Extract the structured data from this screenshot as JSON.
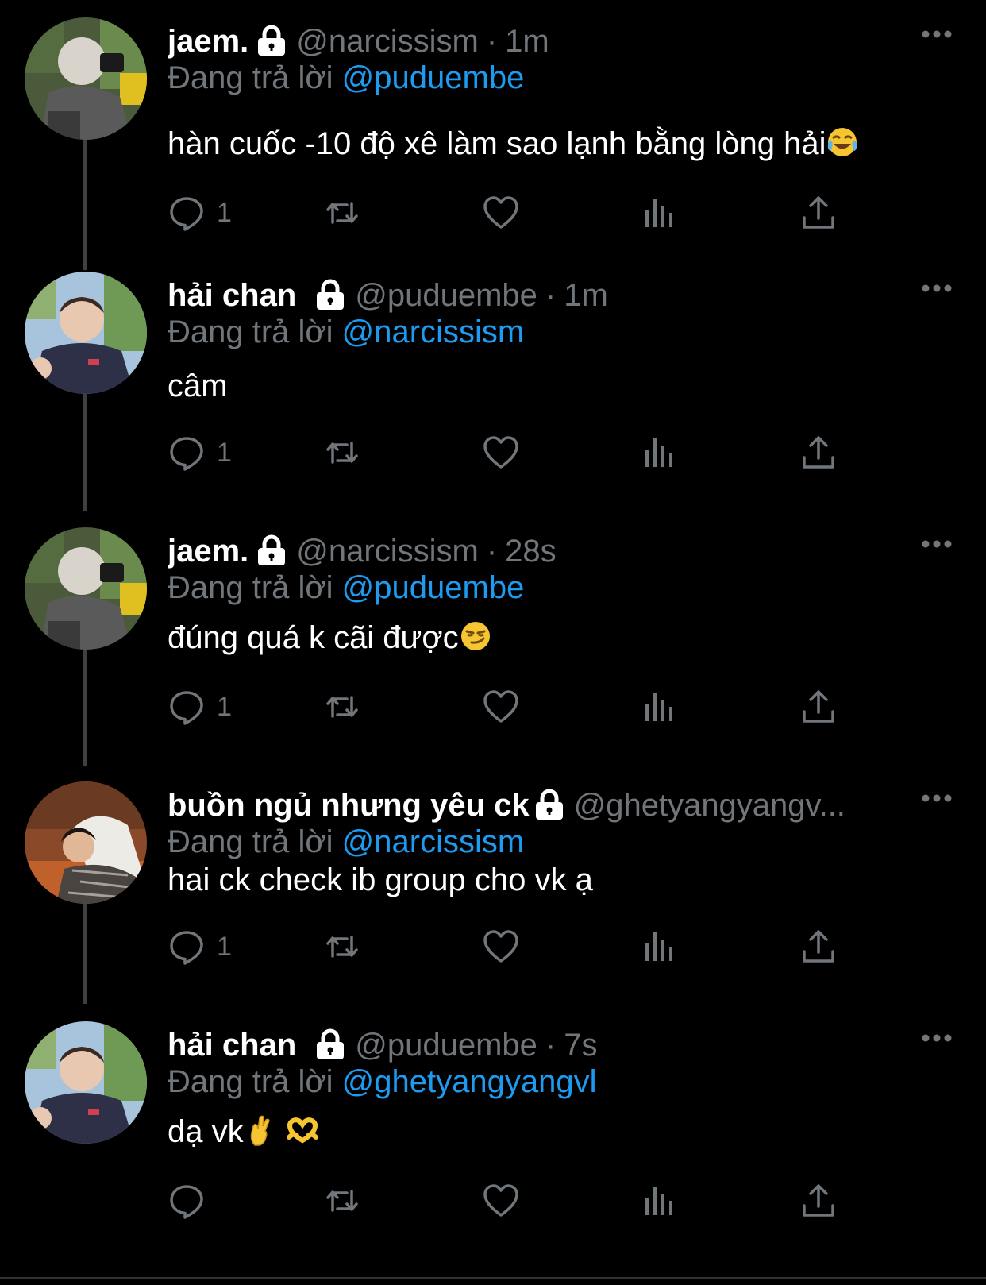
{
  "tweets": [
    {
      "name": "jaem.",
      "handle": "@narcissism",
      "separator": "·",
      "time": "1m",
      "reply_prefix": "Đang trả lời",
      "reply_to": "@puduembe",
      "text": "hàn cuốc -10 độ xê làm sao lạnh bằng lòng hải",
      "reply_count": "1"
    },
    {
      "name": "hải chan",
      "handle": "@puduembe",
      "separator": "·",
      "time": "1m",
      "reply_prefix": "Đang trả lời",
      "reply_to": "@narcissism",
      "text": "câm",
      "reply_count": "1"
    },
    {
      "name": "jaem.",
      "handle": "@narcissism",
      "separator": "·",
      "time": "28s",
      "reply_prefix": "Đang trả lời",
      "reply_to": "@puduembe",
      "text": "đúng quá k cãi được",
      "reply_count": "1"
    },
    {
      "name": "buồn ngủ nhưng yêu ck",
      "handle": "@ghetyangyangv...",
      "separator": "",
      "time": "",
      "reply_prefix": "Đang trả lời",
      "reply_to": "@narcissism",
      "text": "hai ck check ib group cho vk ạ",
      "reply_count": "1"
    },
    {
      "name": "hải chan",
      "handle": "@puduembe",
      "separator": "·",
      "time": "7s",
      "reply_prefix": "Đang trả lời",
      "reply_to": "@ghetyangyangvl",
      "text": "dạ vk",
      "reply_count": ""
    }
  ],
  "colors": {
    "background": "#000000",
    "name": "#ffffff",
    "secondary": "#71767b",
    "mention": "#1d9bf0",
    "thread_line": "#3e4144"
  },
  "icons": [
    "lock-icon",
    "more-icon",
    "reply-icon",
    "retweet-icon",
    "like-icon",
    "views-icon",
    "share-icon",
    "laugh-cry-emoji",
    "smirk-emoji",
    "crossed-fingers-emoji",
    "heart-hands-emoji"
  ]
}
